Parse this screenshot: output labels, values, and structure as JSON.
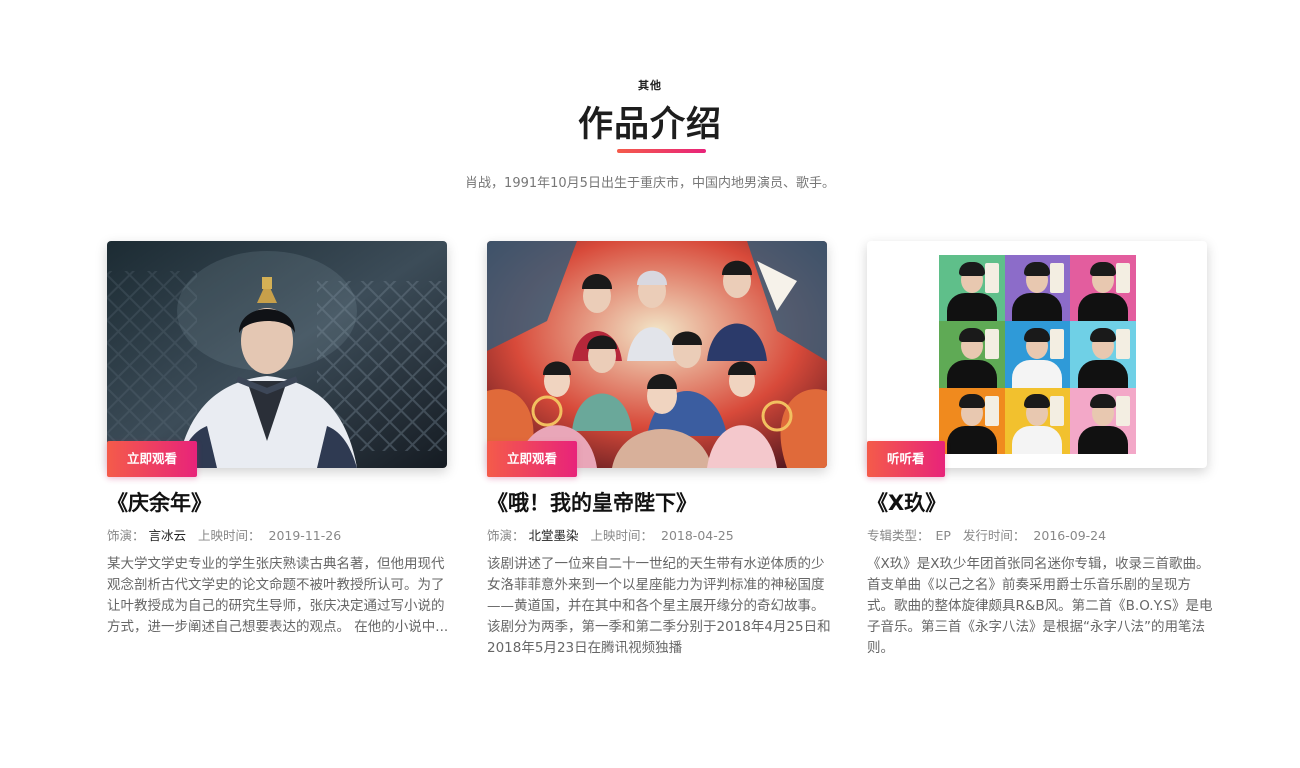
{
  "header": {
    "eyebrow": "其他",
    "title": "作品介绍",
    "subtitle": "肖战，1991年10月5日出生于重庆市，中国内地男演员、歌手。"
  },
  "cards": [
    {
      "title": "《庆余年》",
      "meta_label_1": "饰演：",
      "meta_value_1": "言冰云",
      "meta_label_2": "上映时间：",
      "meta_value_2": "2019-11-26",
      "description": "某大学文学史专业的学生张庆熟读古典名著，但他用现代观念剖析古代文学史的论文命题不被叶教授所认可。为了让叶教授成为自己的研究生导师，张庆决定通过写小说的方式，进一步阐述自己想要表达的观点。 在他的小说中...",
      "button": "立即观看"
    },
    {
      "title": "《哦！我的皇帝陛下》",
      "meta_label_1": "饰演：",
      "meta_value_1": "北堂墨染",
      "meta_label_2": "上映时间：",
      "meta_value_2": "2018-04-25",
      "description": "该剧讲述了一位来自二十一世纪的天生带有水逆体质的少女洛菲菲意外来到一个以星座能力为评判标准的神秘国度——黄道国，并在其中和各个星主展开缘分的奇幻故事。 该剧分为两季，第一季和第二季分别于2018年4月25日和2018年5月23日在腾讯视频独播",
      "button": "立即观看"
    },
    {
      "title": "《X玖》",
      "meta_label_1": "专辑类型：",
      "meta_value_1": "EP",
      "meta_label_2": "发行时间：",
      "meta_value_2": "2016-09-24",
      "description": "《X玖》是X玖少年团首张同名迷你专辑，收录三首歌曲。首支单曲《以己之名》前奏采用爵士乐音乐剧的呈现方式。歌曲的整体旋律颇具R&B风。第二首《B.O.Y.S》是电子音乐。第三首《永字八法》是根据“永字八法”的用笔法则。",
      "button": "听听看"
    }
  ],
  "colors": {
    "accent_start": "#f45b4a",
    "accent_end": "#e8237a",
    "grid_cells": [
      "#5fbf8a",
      "#8c6cc9",
      "#e35d9e",
      "#5faa55",
      "#2f9ad8",
      "#6fd0e6",
      "#f08a1e",
      "#f2c12e",
      "#f3a8c8"
    ]
  }
}
